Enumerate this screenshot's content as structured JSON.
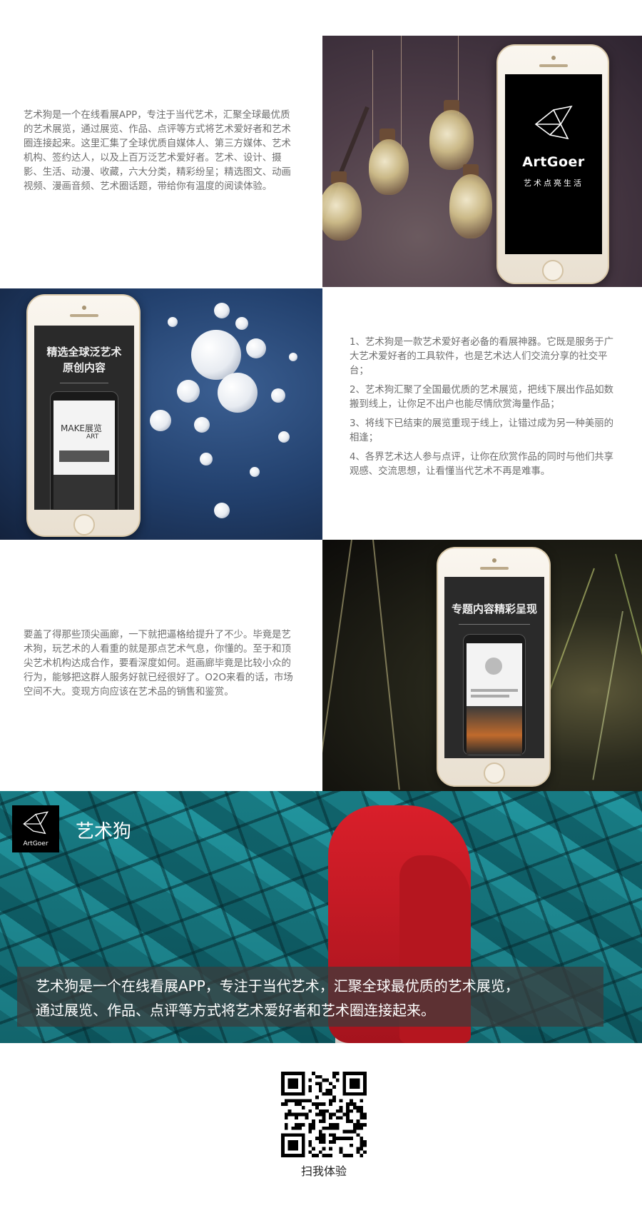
{
  "section1": {
    "paragraph": "艺术狗是一个在线看展APP，专注于当代艺术，汇聚全球最优质的艺术展览，通过展览、作品、点评等方式将艺术爱好者和艺术圈连接起来。这里汇集了全球优质自媒体人、第三方媒体、艺术机构、签约达人，以及上百万泛艺术爱好者。艺术、设计、摄影、生活、动漫、收藏，六大分类，精彩纷呈；精选图文、动画视频、漫画音频、艺术圈话题，带给你有温度的阅读体验。",
    "phone": {
      "brand": "ArtGoer",
      "slogan": "艺术点亮生活"
    }
  },
  "section2": {
    "phone": {
      "promo_line1": "精选全球泛艺术",
      "promo_line2": "原创内容",
      "inner_heading": "MAKE展览",
      "inner_sub": "ART"
    },
    "items": [
      "1、艺术狗是一款艺术爱好者必备的看展神器。它既是服务于广大艺术爱好者的工具软件，也是艺术达人们交流分享的社交平台；",
      "2、艺术狗汇聚了全国最优质的艺术展览，把线下展出作品如数搬到线上，让你足不出户也能尽情欣赏海量作品；",
      "3、将线下已结束的展览重现于线上，让错过成为另一种美丽的相逢；",
      "4、各界艺术达人参与点评，让你在欣赏作品的同时与他们共享观感、交流思想，让看懂当代艺术不再是难事。"
    ]
  },
  "section3": {
    "paragraph": "要盖了得那些顶尖画廊，一下就把逼格给提升了不少。毕竟是艺术狗，玩艺术的人看重的就是那点艺术气息，你懂的。至于和顶尖艺术机构达成合作，要看深度如何。逛画廊毕竟是比较小众的行为，能够把这群人服务好就已经很好了。O2O来看的话，市场空间不大。变现方向应该在艺术品的销售和鉴赏。",
    "phone": {
      "promo": "专题内容精彩呈现"
    }
  },
  "banner": {
    "logo_text": "ArtGoer",
    "title": "艺术狗",
    "caption_line1": "艺术狗是一个在线看展APP，专注于当代艺术，汇聚全球最优质的艺术展览，",
    "caption_line2": "通过展览、作品、点评等方式将艺术爱好者和艺术圈连接起来。"
  },
  "footer": {
    "qr_label": "扫我体验"
  }
}
